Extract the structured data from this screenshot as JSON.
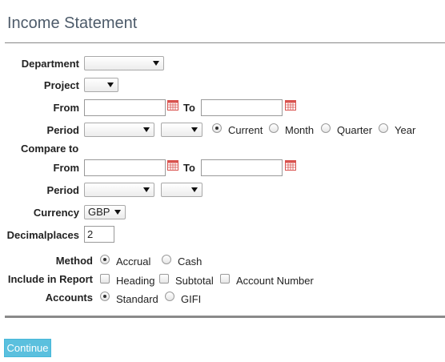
{
  "title": "Income Statement",
  "labels": {
    "department": "Department",
    "project": "Project",
    "from": "From",
    "to": "To",
    "period": "Period",
    "compare_to": "Compare to",
    "currency": "Currency",
    "decimalplaces": "Decimalplaces",
    "method": "Method",
    "include_in_report": "Include in Report",
    "accounts": "Accounts"
  },
  "period_options": {
    "current": "Current",
    "month": "Month",
    "quarter": "Quarter",
    "year": "Year",
    "selected": "Current"
  },
  "currency": {
    "selected": "GBP"
  },
  "decimalplaces": {
    "value": "2"
  },
  "method": {
    "accrual": "Accrual",
    "cash": "Cash",
    "selected": "Accrual"
  },
  "include": {
    "heading": "Heading",
    "subtotal": "Subtotal",
    "account_number": "Account Number"
  },
  "accounts": {
    "standard": "Standard",
    "gifi": "GIFI",
    "selected": "Standard"
  },
  "continue_label": "Continue",
  "colors": {
    "accent": "#5bc0de",
    "title": "#4d5b6a",
    "calendar": "#d9534f"
  }
}
